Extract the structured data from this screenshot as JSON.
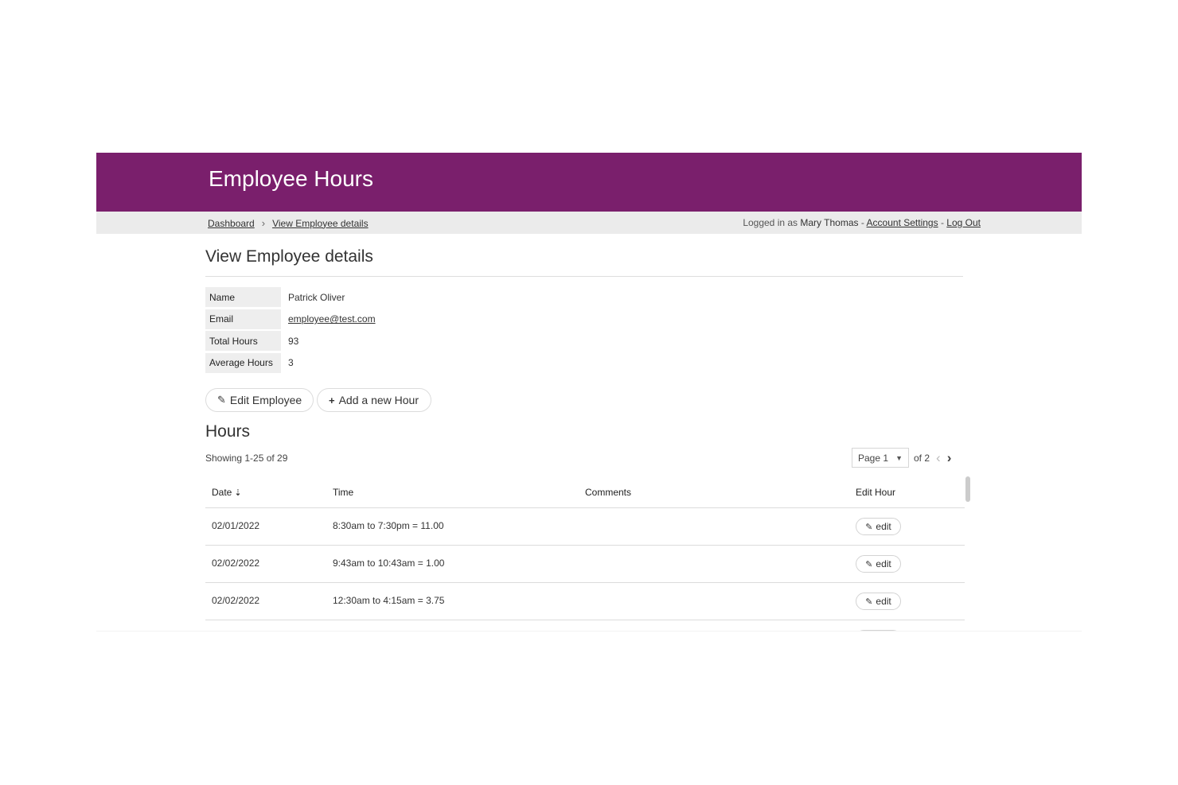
{
  "header": {
    "title": "Employee Hours",
    "bg_color": "#7a1f6c"
  },
  "breadcrumb": {
    "items": [
      "Dashboard",
      "View Employee details"
    ],
    "separator": "›"
  },
  "user": {
    "prefix": "Logged in as",
    "name": "Mary Thomas",
    "sep1": "-",
    "account_settings": "Account Settings",
    "sep2": "-",
    "logout": "Log Out"
  },
  "page": {
    "title": "View Employee details"
  },
  "details": [
    {
      "label": "Name",
      "value": "Patrick Oliver"
    },
    {
      "label": "Email",
      "value": "employee@test.com"
    },
    {
      "label": "Total Hours",
      "value": "93"
    },
    {
      "label": "Average Hours",
      "value": "3"
    }
  ],
  "actions": {
    "edit_employee": "Edit Employee",
    "add_hour": "Add a new Hour"
  },
  "hours": {
    "title": "Hours",
    "showing": "Showing 1-25 of 29",
    "pager": {
      "page_select": "Page 1",
      "of_text": "of 2"
    },
    "columns": [
      "Date",
      "Time",
      "Comments",
      "Edit Hour"
    ],
    "rows": [
      {
        "date": "02/01/2022",
        "time": "8:30am to 7:30pm = 11.00",
        "comments": "",
        "edit": "edit"
      },
      {
        "date": "02/02/2022",
        "time": "9:43am to 10:43am = 1.00",
        "comments": "",
        "edit": "edit"
      },
      {
        "date": "02/02/2022",
        "time": "12:30am to 4:15am = 3.75",
        "comments": "",
        "edit": "edit"
      }
    ]
  },
  "icons": {
    "edit": "pencil-square-icon",
    "add": "plus-icon",
    "sort": "sort-ascending-icon",
    "chevron_down": "chevron-down-icon",
    "prev": "chevron-left-icon",
    "next": "chevron-right-icon"
  }
}
